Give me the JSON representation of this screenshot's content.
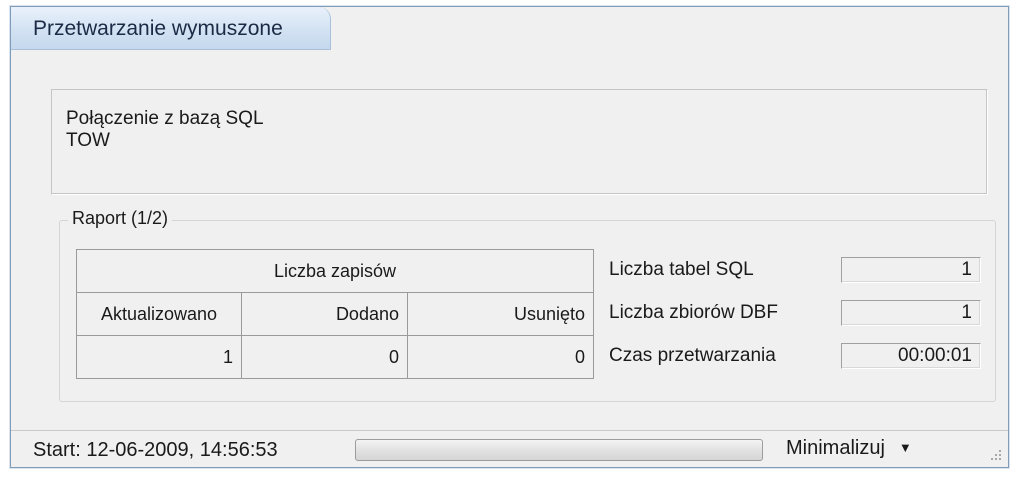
{
  "window": {
    "title": "Przetwarzanie wymuszone"
  },
  "info": {
    "line1": "Połączenie z bazą SQL",
    "line2": "TOW"
  },
  "report": {
    "legend": "Raport (1/2)",
    "table": {
      "group_header": "Liczba zapisów",
      "columns": [
        "Aktualizowano",
        "Dodano",
        "Usunięto"
      ],
      "values": [
        "1",
        "0",
        "0"
      ]
    },
    "stats": [
      {
        "label": "Liczba tabel SQL",
        "value": "1"
      },
      {
        "label": "Liczba zbiorów DBF",
        "value": "1"
      },
      {
        "label": "Czas przetwarzania",
        "value": "00:00:01"
      }
    ]
  },
  "statusbar": {
    "start_text": "Start: 12-06-2009, 14:56:53",
    "progress": 0,
    "minimize_label": "Minimalizuj"
  }
}
